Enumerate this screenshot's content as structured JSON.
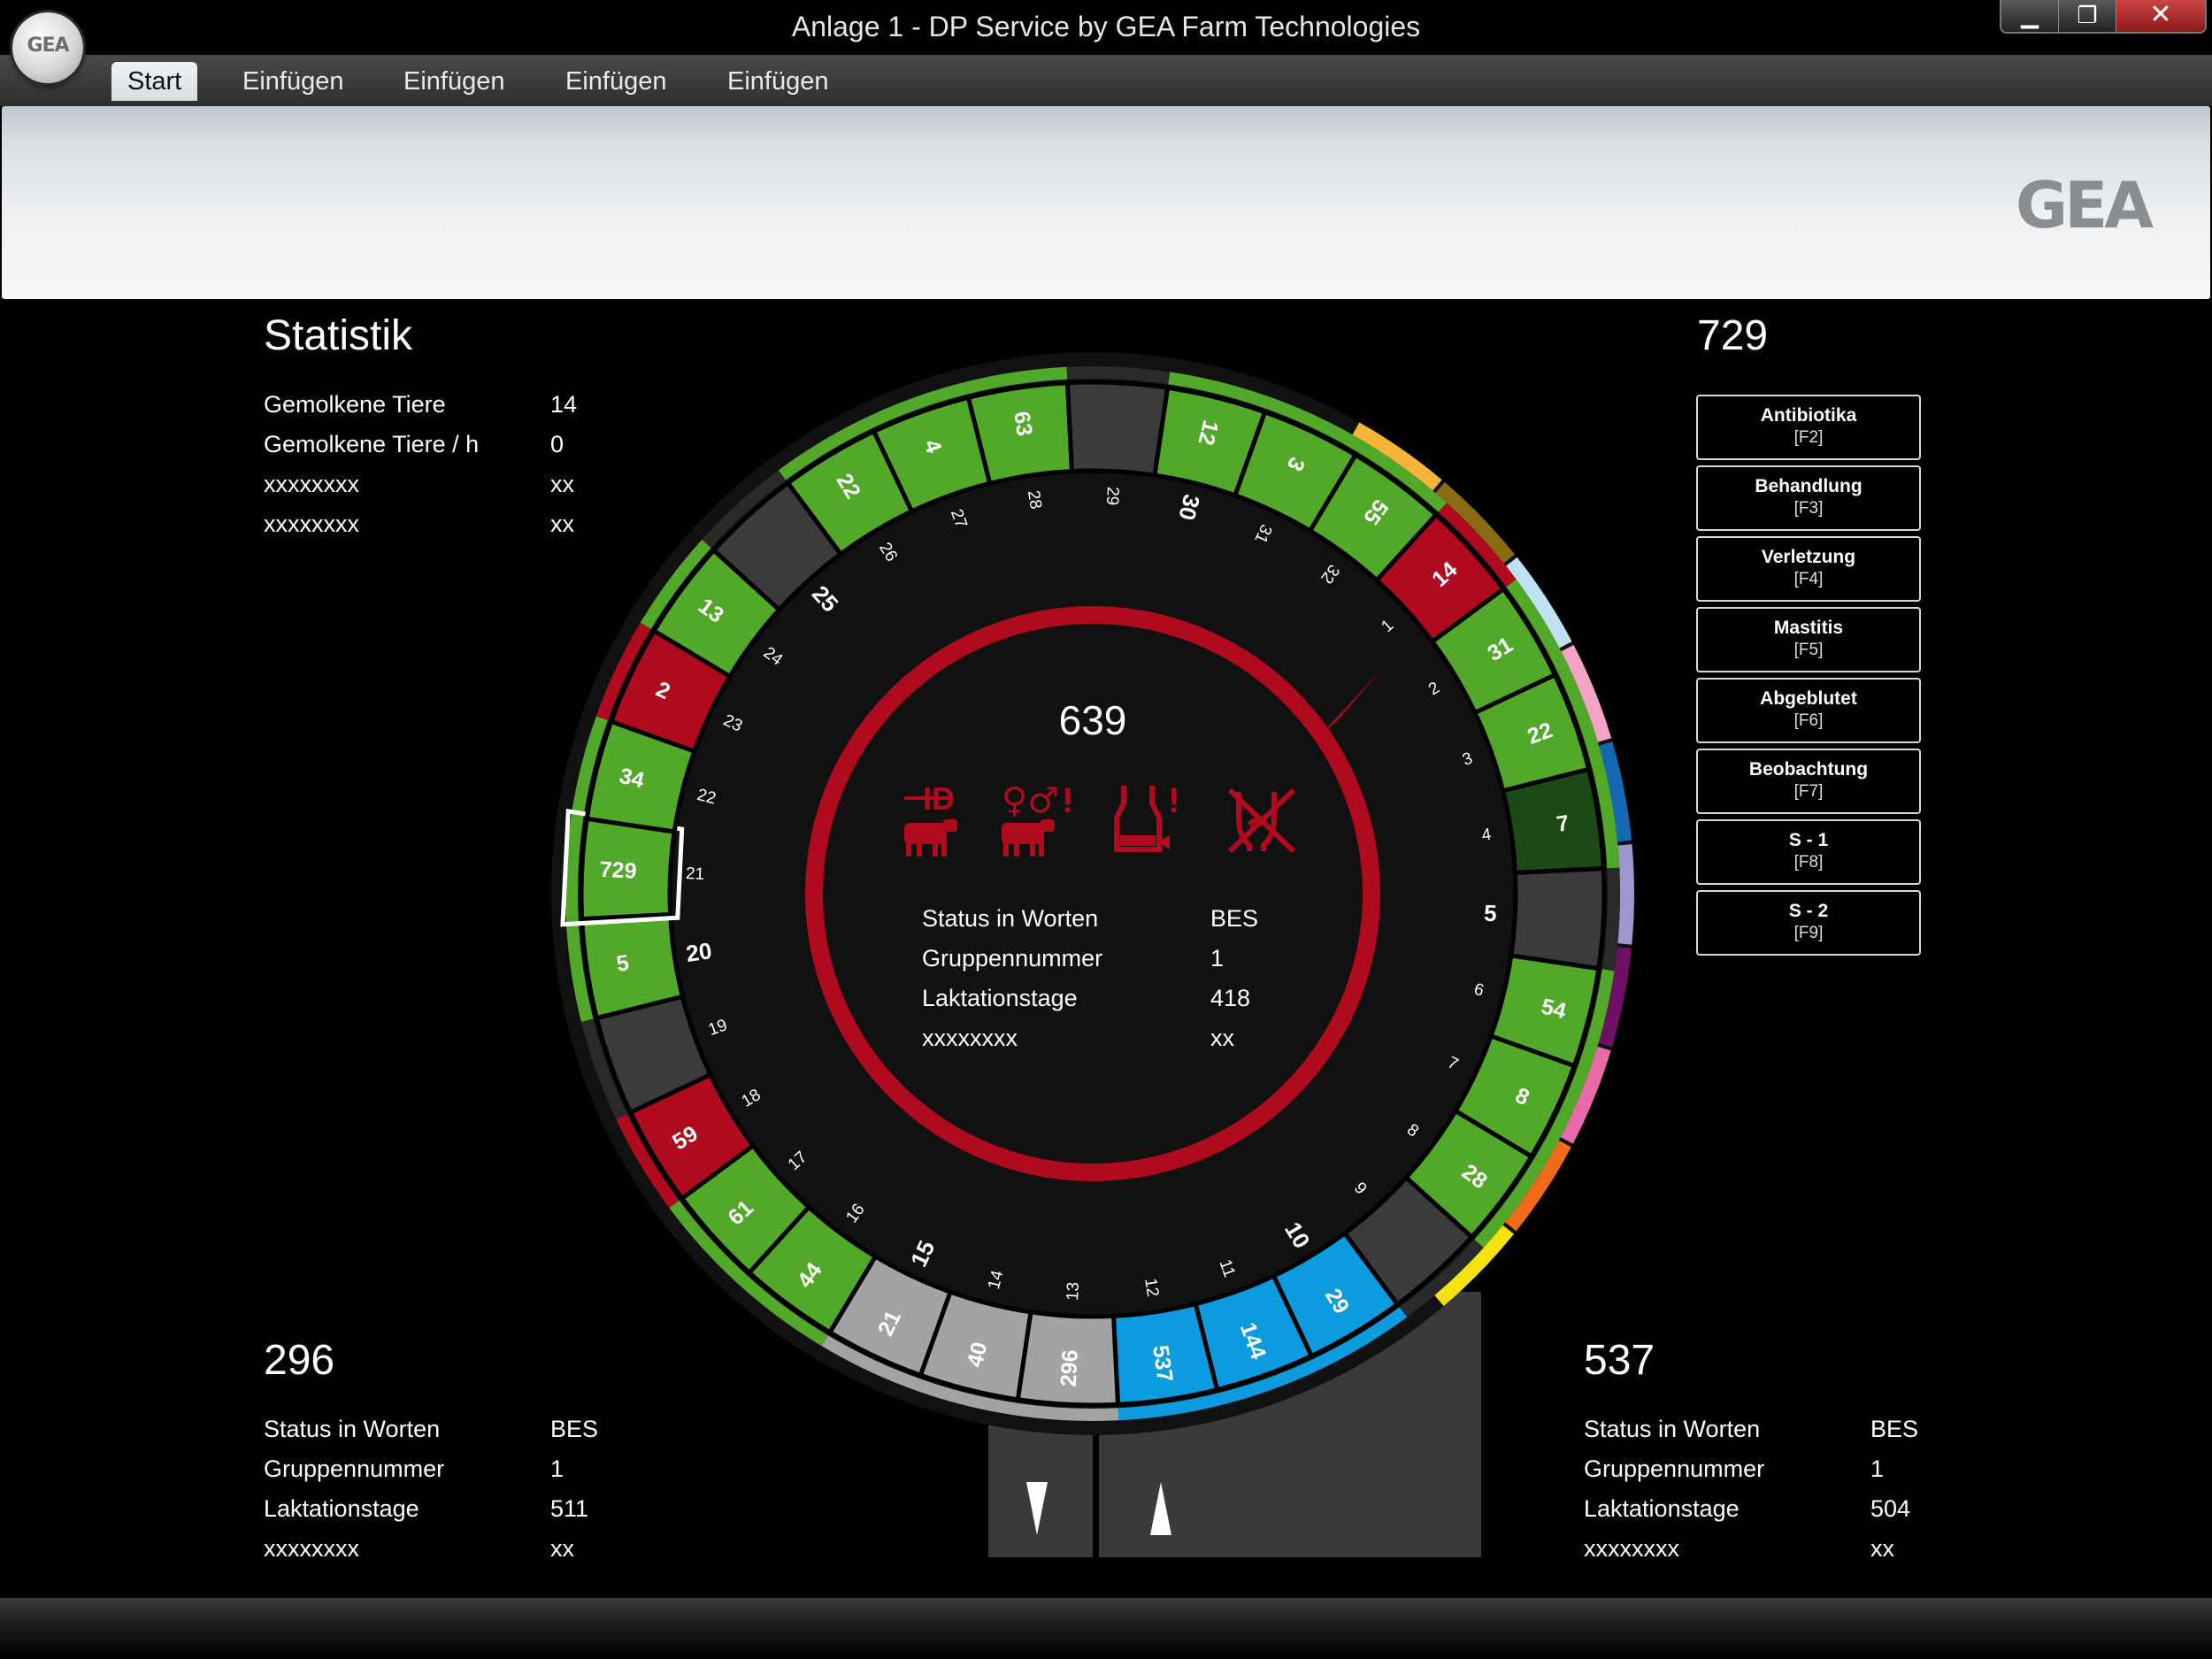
{
  "window": {
    "title": "Anlage 1  - DP Service by GEA Farm Technologies",
    "orb_logo": "GEA",
    "brand_logo": "GEA",
    "controls": {
      "minimize": "▁",
      "maximize": "❐",
      "close": "✕"
    }
  },
  "tabs": [
    {
      "label": "Start",
      "active": true
    },
    {
      "label": "Einfügen",
      "active": false
    },
    {
      "label": "Einfügen",
      "active": false
    },
    {
      "label": "Einfügen",
      "active": false
    },
    {
      "label": "Einfügen",
      "active": false
    }
  ],
  "statistics": {
    "title": "Statistik",
    "rows": [
      {
        "label": "Gemolkene Tiere",
        "value": "14"
      },
      {
        "label": "Gemolkene Tiere / h",
        "value": "0"
      },
      {
        "label": "xxxxxxxx",
        "value": "xx"
      },
      {
        "label": "xxxxxxxx",
        "value": "xx"
      }
    ]
  },
  "selected_animal": {
    "number": "729",
    "actions": [
      {
        "label": "Antibiotika",
        "key": "[F2]"
      },
      {
        "label": "Behandlung",
        "key": "[F3]"
      },
      {
        "label": "Verletzung",
        "key": "[F4]"
      },
      {
        "label": "Mastitis",
        "key": "[F5]"
      },
      {
        "label": "Abgeblutet",
        "key": "[F6]"
      },
      {
        "label": "Beobachtung",
        "key": "[F7]"
      },
      {
        "label": "S - 1",
        "key": "[F8]"
      },
      {
        "label": "S - 2",
        "key": "[F9]"
      }
    ]
  },
  "center": {
    "animal": "639",
    "ring_color": "#b00a1e",
    "icons": [
      "id-cow-icon",
      "gender-alert-icon",
      "milk-alert-icon",
      "no-milking-icon"
    ],
    "rows": [
      {
        "label": "Status in Worten",
        "value": "BES"
      },
      {
        "label": "Gruppennummer",
        "value": "1"
      },
      {
        "label": "Laktationstage",
        "value": "418"
      },
      {
        "label": "xxxxxxxx",
        "value": "xx"
      }
    ]
  },
  "exit_animal": {
    "number": "296",
    "rows": [
      {
        "label": "Status in Worten",
        "value": "BES"
      },
      {
        "label": "Gruppennummer",
        "value": "1"
      },
      {
        "label": "Laktationstage",
        "value": "511"
      },
      {
        "label": "xxxxxxxx",
        "value": "xx"
      }
    ]
  },
  "entry_animal": {
    "number": "537",
    "rows": [
      {
        "label": "Status in Worten",
        "value": "BES"
      },
      {
        "label": "Gruppennummer",
        "value": "1"
      },
      {
        "label": "Laktationstage",
        "value": "504"
      },
      {
        "label": "xxxxxxxx",
        "value": "xx"
      }
    ]
  },
  "rotary": {
    "colors": {
      "green": "#52a829",
      "red": "#b00a1e",
      "dark": "#3b3b3b",
      "gray": "#a3a3a3",
      "blue": "#0d9be0",
      "dark_green": "#1c4a14",
      "highlight": "#ffffff"
    },
    "bold_stall_numbers": [
      "5",
      "10",
      "15",
      "20",
      "25",
      "30"
    ],
    "stalls": [
      {
        "stall": "1",
        "cow": "14",
        "state": "red"
      },
      {
        "stall": "2",
        "cow": "31",
        "state": "green"
      },
      {
        "stall": "3",
        "cow": "22",
        "state": "green"
      },
      {
        "stall": "4",
        "cow": "7",
        "state": "dark_green"
      },
      {
        "stall": "5",
        "cow": "",
        "state": "dark"
      },
      {
        "stall": "6",
        "cow": "54",
        "state": "green"
      },
      {
        "stall": "7",
        "cow": "8",
        "state": "green"
      },
      {
        "stall": "8",
        "cow": "28",
        "state": "green"
      },
      {
        "stall": "9",
        "cow": "",
        "state": "dark"
      },
      {
        "stall": "10",
        "cow": "29",
        "state": "blue"
      },
      {
        "stall": "11",
        "cow": "144",
        "state": "blue"
      },
      {
        "stall": "12",
        "cow": "537",
        "state": "blue"
      },
      {
        "stall": "13",
        "cow": "296",
        "state": "gray"
      },
      {
        "stall": "14",
        "cow": "40",
        "state": "gray"
      },
      {
        "stall": "15",
        "cow": "21",
        "state": "gray"
      },
      {
        "stall": "16",
        "cow": "44",
        "state": "green"
      },
      {
        "stall": "17",
        "cow": "61",
        "state": "green"
      },
      {
        "stall": "18",
        "cow": "59",
        "state": "red"
      },
      {
        "stall": "19",
        "cow": "",
        "state": "dark"
      },
      {
        "stall": "20",
        "cow": "5",
        "state": "green"
      },
      {
        "stall": "21",
        "cow": "729",
        "state": "green",
        "selected": true
      },
      {
        "stall": "22",
        "cow": "34",
        "state": "green"
      },
      {
        "stall": "23",
        "cow": "2",
        "state": "red"
      },
      {
        "stall": "24",
        "cow": "13",
        "state": "green"
      },
      {
        "stall": "25",
        "cow": "",
        "state": "dark"
      },
      {
        "stall": "26",
        "cow": "22",
        "state": "green"
      },
      {
        "stall": "27",
        "cow": "4",
        "state": "green"
      },
      {
        "stall": "28",
        "cow": "63",
        "state": "green"
      },
      {
        "stall": "29",
        "cow": "",
        "state": "dark"
      },
      {
        "stall": "30",
        "cow": "12",
        "state": "green"
      },
      {
        "stall": "31",
        "cow": "3",
        "state": "green"
      },
      {
        "stall": "32",
        "cow": "55",
        "state": "green"
      }
    ],
    "group_strip_colors": [
      "#f5b33a",
      "#8b6a14",
      "#bfe2f2",
      "#f4a2c6",
      "#1467b0",
      "#9e96cf",
      "#6e0f66",
      "#e86aa8",
      "#f06a1c",
      "#f5e20e"
    ]
  }
}
